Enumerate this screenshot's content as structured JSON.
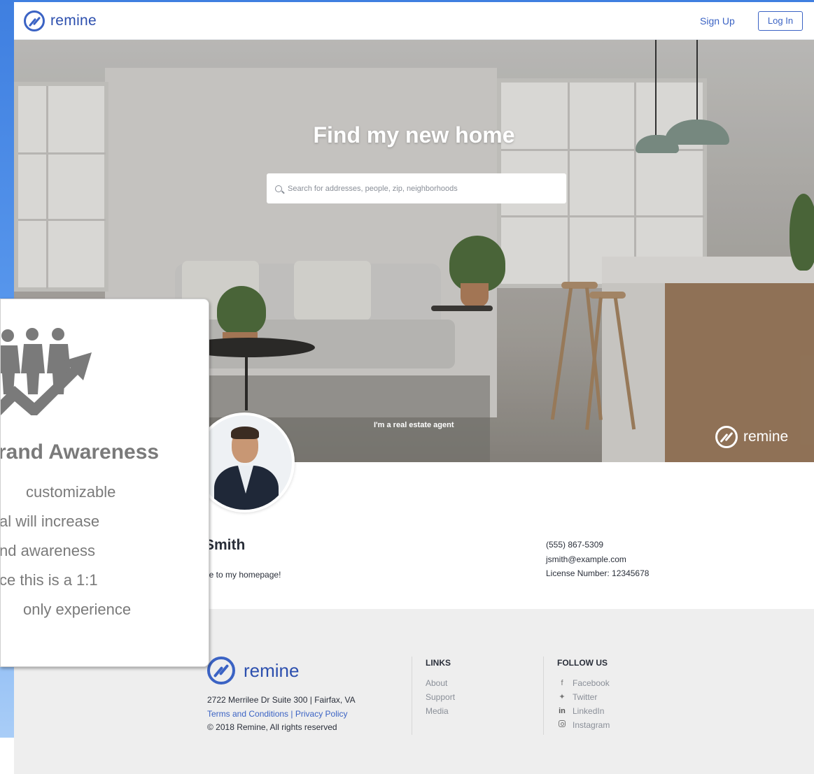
{
  "header": {
    "brand": "remine",
    "signup_label": "Sign Up",
    "login_label": "Log In"
  },
  "hero": {
    "title": "Find my new home",
    "search_placeholder": "Search for addresses, people, zip, neighborhoods",
    "agent_link": "I'm a real estate agent",
    "watermark_brand": "remine"
  },
  "agent": {
    "name_fragment": "Smith",
    "welcome_fragment": "ne to my homepage!",
    "phone": "(555) 867-5309",
    "email": "jsmith@example.com",
    "license": "License Number: 12345678"
  },
  "footer": {
    "brand": "remine",
    "address": "2722 Merrilee Dr Suite 300 | Fairfax, VA",
    "terms": "Terms and Conditions",
    "separator": " | ",
    "privacy": "Privacy Policy",
    "copyright": "© 2018 Remine, All rights reserved",
    "links_title": "LINKS",
    "links": [
      "About",
      "Support",
      "Media"
    ],
    "follow_title": "FOLLOW US",
    "social": [
      "Facebook",
      "Twitter",
      "LinkedIn",
      "Instagram"
    ]
  },
  "overlay": {
    "title": "rand Awareness",
    "lines": [
      "customizable",
      "al will increase",
      "nd awareness",
      "ce this is a 1:1",
      "only experience"
    ]
  },
  "colors": {
    "brand_blue": "#3b63c4",
    "slide_blue": "#3f7fe0",
    "footer_bg": "#eeeeee",
    "overlay_gray": "#7a7a7a"
  },
  "icons": {
    "header_logo": "remine-logo-icon",
    "search": "search-icon",
    "facebook": "facebook-icon",
    "twitter": "twitter-icon",
    "linkedin": "linkedin-icon",
    "instagram": "instagram-icon",
    "overlay": "brand-awareness-icon"
  }
}
